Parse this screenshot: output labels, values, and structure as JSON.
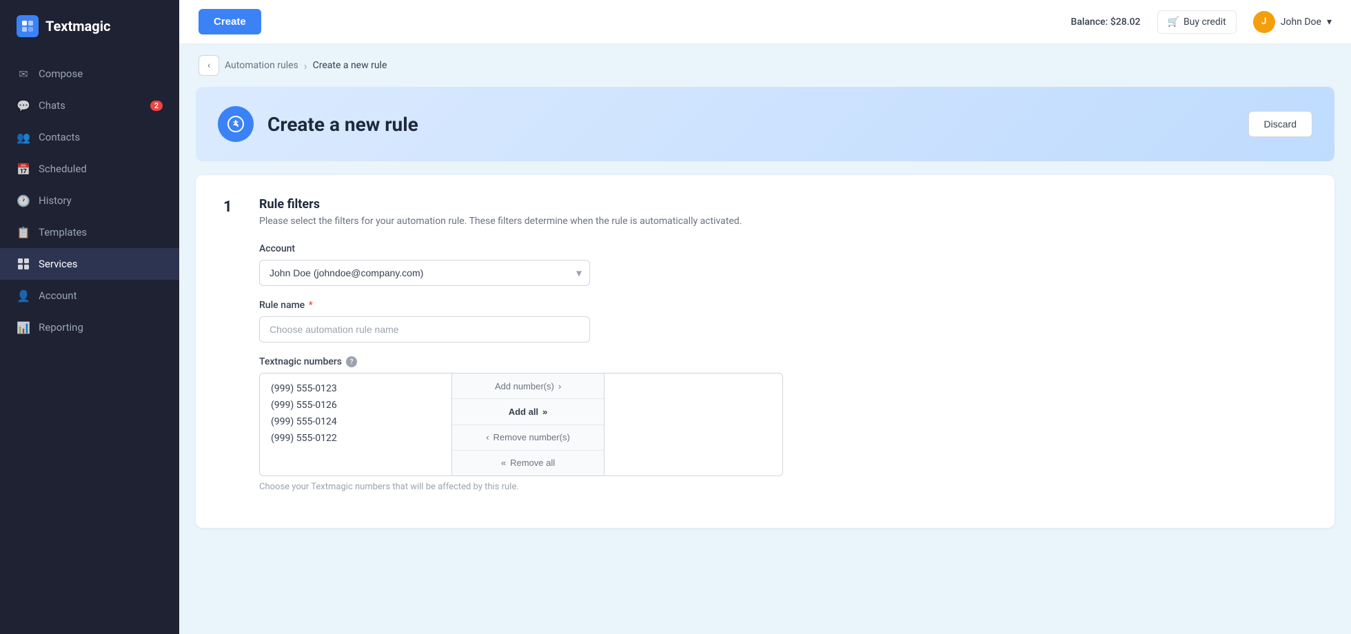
{
  "app": {
    "name": "Textmagic"
  },
  "header": {
    "create_label": "Create",
    "balance_label": "Balance: $28.02",
    "buy_credit_label": "Buy credit",
    "user_name": "John Doe",
    "user_initial": "J"
  },
  "breadcrumb": {
    "back_title": "back",
    "parent": "Automation rules",
    "current": "Create a new rule"
  },
  "page": {
    "title": "Create a new rule",
    "discard_label": "Discard"
  },
  "form": {
    "step_number": "1",
    "section_title": "Rule filters",
    "section_desc": "Please select the filters for your automation rule. These filters determine when the rule is automatically activated.",
    "account_label": "Account",
    "account_value": "John Doe (johndoe@company.com)",
    "rule_name_label": "Rule name",
    "rule_name_placeholder": "Choose automation rule name",
    "numbers_label": "Textnagic numbers",
    "numbers_help_title": "help",
    "numbers_note": "Choose your Textmagic numbers that will be affected by this rule.",
    "numbers_list": [
      "(999) 555-0123",
      "(999) 555-0126",
      "(999) 555-0124",
      "(999) 555-0122"
    ],
    "add_numbers_label": "Add number(s)",
    "add_all_label": "Add all",
    "remove_numbers_label": "Remove number(s)",
    "remove_all_label": "Remove all"
  },
  "sidebar": {
    "items": [
      {
        "id": "compose",
        "label": "Compose",
        "icon": "✉"
      },
      {
        "id": "chats",
        "label": "Chats",
        "icon": "💬",
        "badge": "2"
      },
      {
        "id": "contacts",
        "label": "Contacts",
        "icon": "👥"
      },
      {
        "id": "scheduled",
        "label": "Scheduled",
        "icon": "📅"
      },
      {
        "id": "history",
        "label": "History",
        "icon": "🕐"
      },
      {
        "id": "templates",
        "label": "Templates",
        "icon": "📋"
      },
      {
        "id": "services",
        "label": "Services",
        "icon": "⚙",
        "active": true
      },
      {
        "id": "account",
        "label": "Account",
        "icon": "👤"
      },
      {
        "id": "reporting",
        "label": "Reporting",
        "icon": "📊"
      }
    ]
  }
}
